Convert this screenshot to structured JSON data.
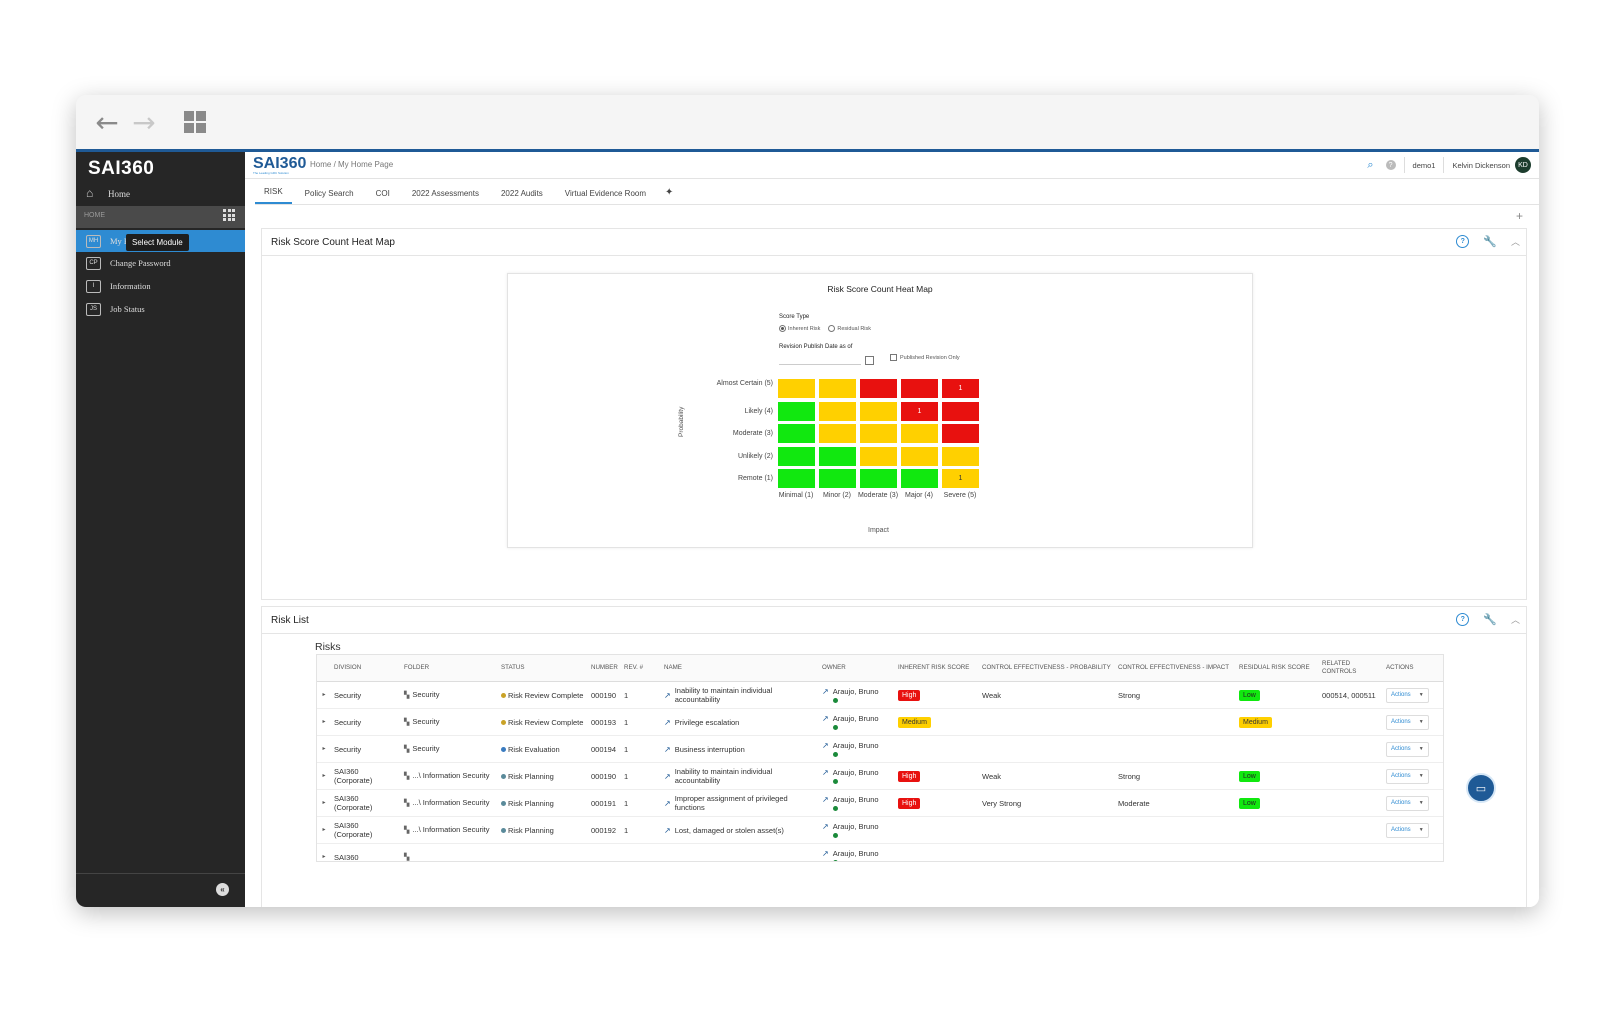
{
  "browser": {
    "back_icon": "arrow-left-icon",
    "forward_icon": "arrow-right-icon",
    "apps_icon": "grid-icon"
  },
  "sidebar": {
    "logo": "SAI360",
    "home_label": "Home",
    "section_label": "HOME",
    "items": [
      {
        "badge": "MH",
        "label": "My H"
      },
      {
        "badge": "CP",
        "label": "Change Password"
      },
      {
        "badge": "I",
        "label": "Information"
      },
      {
        "badge": "JS",
        "label": "Job Status"
      }
    ],
    "tooltip": "Select Module",
    "collapse_label": "«"
  },
  "header": {
    "logo": "SAI360",
    "logo_tagline": "The Leading GRC Solution",
    "breadcrumb": "Home / My Home Page",
    "tenant": "demo1",
    "user": "Kelvin Dickenson",
    "avatar": "KD"
  },
  "tabs": [
    "RISK",
    "Policy Search",
    "COI",
    "2022 Assessments",
    "2022 Audits",
    "Virtual Evidence Room"
  ],
  "tab_add": "✦",
  "add_panel": "+",
  "heatmap_panel": {
    "title": "Risk Score Count Heat Map",
    "card_title": "Risk Score Count Heat Map",
    "score_type_label": "Score Type",
    "inherent": "Inherent Risk",
    "residual": "Residual Risk",
    "revision_label": "Revision Publish Date as of",
    "published_only": "Published Revision Only",
    "y_axis": "Probability",
    "x_axis": "Impact",
    "rows": [
      "Almost Certain (5)",
      "Likely (4)",
      "Moderate (3)",
      "Unlikely (2)",
      "Remote (1)"
    ],
    "cols": [
      "Minimal (1)",
      "Minor (2)",
      "Moderate (3)",
      "Major (4)",
      "Severe (5)"
    ],
    "colors": {
      "green": "#11e80f",
      "yellow": "#ffd000",
      "red": "#e8110f"
    },
    "matrix": [
      [
        "yellow",
        "yellow",
        "red",
        "red",
        "red"
      ],
      [
        "green",
        "yellow",
        "yellow",
        "red",
        "red"
      ],
      [
        "green",
        "yellow",
        "yellow",
        "yellow",
        "red"
      ],
      [
        "green",
        "green",
        "yellow",
        "yellow",
        "yellow"
      ],
      [
        "green",
        "green",
        "green",
        "green",
        "yellow"
      ]
    ],
    "counts": [
      [
        "",
        "",
        "",
        "",
        "1"
      ],
      [
        "",
        "",
        "",
        "1",
        ""
      ],
      [
        "",
        "",
        "",
        "",
        ""
      ],
      [
        "",
        "",
        "",
        "",
        ""
      ],
      [
        "",
        "",
        "",
        "",
        "1"
      ]
    ]
  },
  "risk_panel": {
    "title": "Risk List",
    "table_title": "Risks",
    "columns": [
      "",
      "DIVISION",
      "FOLDER",
      "STATUS",
      "NUMBER",
      "REV. #",
      "NAME",
      "OWNER",
      "INHERENT RISK SCORE",
      "CONTROL EFFECTIVENESS - PROBABILITY",
      "CONTROL EFFECTIVENESS - IMPACT",
      "RESIDUAL RISK SCORE",
      "RELATED CONTROLS",
      "ACTIONS"
    ],
    "rows": [
      {
        "division": "Security",
        "folder": "Security",
        "status": "Risk Review Complete",
        "status_color": "#c9a227",
        "number": "000190",
        "rev": "1",
        "name": "Inability to maintain individual accountability",
        "owner": "Araujo, Bruno",
        "inherent": "High",
        "inherent_class": "high",
        "ce_prob": "Weak",
        "ce_impact": "Strong",
        "residual": "Low",
        "residual_class": "low",
        "controls": "000514, 000511",
        "actions": "Actions"
      },
      {
        "division": "Security",
        "folder": "Security",
        "status": "Risk Review Complete",
        "status_color": "#c9a227",
        "number": "000193",
        "rev": "1",
        "name": "Privilege escalation",
        "owner": "Araujo, Bruno",
        "inherent": "Medium",
        "inherent_class": "medium",
        "ce_prob": "",
        "ce_impact": "",
        "residual": "Medium",
        "residual_class": "medium",
        "controls": "",
        "actions": "Actions"
      },
      {
        "division": "Security",
        "folder": "Security",
        "status": "Risk Evaluation",
        "status_color": "#3a7bbf",
        "number": "000194",
        "rev": "1",
        "name": "Business interruption",
        "owner": "Araujo, Bruno",
        "inherent": "",
        "inherent_class": "",
        "ce_prob": "",
        "ce_impact": "",
        "residual": "",
        "residual_class": "",
        "controls": "",
        "actions": "Actions"
      },
      {
        "division": "SAI360 (Corporate)",
        "folder": "...\\ Information Security",
        "status": "Risk Planning",
        "status_color": "#5a8a9a",
        "number": "000190",
        "rev": "1",
        "name": "Inability to maintain individual accountability",
        "owner": "Araujo, Bruno",
        "inherent": "High",
        "inherent_class": "high",
        "ce_prob": "Weak",
        "ce_impact": "Strong",
        "residual": "Low",
        "residual_class": "low",
        "controls": "",
        "actions": "Actions"
      },
      {
        "division": "SAI360 (Corporate)",
        "folder": "...\\ Information Security",
        "status": "Risk Planning",
        "status_color": "#5a8a9a",
        "number": "000191",
        "rev": "1",
        "name": "Improper assignment of privileged functions",
        "owner": "Araujo, Bruno",
        "inherent": "High",
        "inherent_class": "high",
        "ce_prob": "Very Strong",
        "ce_impact": "Moderate",
        "residual": "Low",
        "residual_class": "low",
        "controls": "",
        "actions": "Actions"
      },
      {
        "division": "SAI360 (Corporate)",
        "folder": "...\\ Information Security",
        "status": "Risk Planning",
        "status_color": "#5a8a9a",
        "number": "000192",
        "rev": "1",
        "name": "Lost, damaged or stolen asset(s)",
        "owner": "Araujo, Bruno",
        "inherent": "",
        "inherent_class": "",
        "ce_prob": "",
        "ce_impact": "",
        "residual": "",
        "residual_class": "",
        "controls": "",
        "actions": "Actions"
      },
      {
        "division": "SAI360",
        "folder": "",
        "status": "",
        "status_color": "#5a8a9a",
        "number": "",
        "rev": "",
        "name": "",
        "owner": "Araujo, Bruno",
        "inherent": "",
        "inherent_class": "",
        "ce_prob": "",
        "ce_impact": "",
        "residual": "",
        "residual_class": "",
        "controls": "",
        "actions": ""
      }
    ]
  }
}
